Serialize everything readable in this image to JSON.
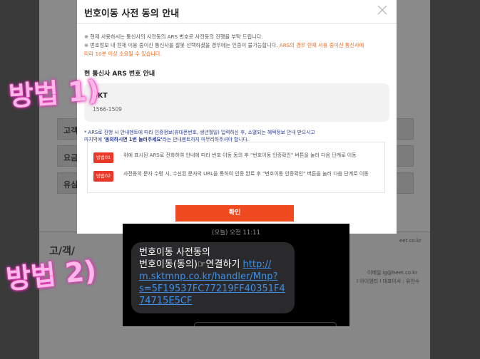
{
  "background": {
    "rows": [
      {
        "label": "고객"
      },
      {
        "label": "요금"
      },
      {
        "label": "유심"
      }
    ],
    "footer_title": "고/객/",
    "footer_right_1": "eet.co.kr",
    "footer_right_2": "이메일 ig@heet.co.kr",
    "footer_right_3": "I 아이엠티 I 대표이사 : 유인수"
  },
  "modal": {
    "title": "번호이동 사전 동의 안내",
    "close_icon": "close-icon",
    "notice_1": "※ 현재 사용하시는 통신사의 사전동의 ARS 번호로 사전동의 진행을 부탁 드립니다.",
    "notice_2": "※ 번호정보 내 현재 이용 중이신 통신사를 잘못 선택하셨을 경우에는 인증이 불가능합니다. ",
    "notice_2_orange": "ARS의 경우 현재 사용 중이신 통신사에",
    "notice_3_orange": "따라 10분 이상 소요될 수 있습니다.",
    "section_title": "현 통신사 ARS 번호 안내",
    "carrier_name": "SKT",
    "carrier_phone": "1566-1509",
    "ars_note_1": "* ARS로 진행 시 안내멘트에 따라 인증정보(휴대폰번호, 생년월일) 입력하신 후, 소멸되는 혜택정보 안내 받으시고",
    "ars_note_2_pre": "마지막에 ",
    "ars_note_2_emph": "'동의하시면 1번 눌러주세요'",
    "ars_note_2_post": "라는 안내멘트까지 마무리하주셔야 합니다.",
    "methods": [
      {
        "badge": "방법01",
        "text": "위에 표시된 ARS로 전화하여 안내에 따라 번호 이동 동의 후 \"번호이동 인증확인\" 버튼을 눌러 다음 단계로 이동"
      },
      {
        "badge": "방법02",
        "text": "사전동의 문자 수령 시, 수신된 문자의 URL을 통하여 인증 완료 후 \"번호이동 인증확인\" 버튼을 눌러 다음 단계로 이동"
      }
    ],
    "confirm_label": "확인"
  },
  "annotations": {
    "method_1": "방법 1)",
    "method_2": "방법 2)"
  },
  "sms": {
    "timestamp": "(오늘) 오전 11:11",
    "line_1": "번호이동 사전동의",
    "line_2": "번호이동(동의)☞연결하기 ",
    "link": "http://m.sktmnp.co.kr/handler/Mnp?s=5F19537FC77219FF40351F474715E5CF",
    "link_display_1": "http://",
    "link_display_2": "m.sktmnp.co.kr/handler/Mnp?",
    "link_display_3": "s=5F19537FC77219FF40351F4",
    "link_display_4": "74715E5CF"
  },
  "colors": {
    "accent": "#f04a20",
    "badge": "#e8392b",
    "note_blue": "#2a3b8f",
    "link_blue": "#3f8fe8",
    "annotation_pink": "#ff3fc8"
  }
}
